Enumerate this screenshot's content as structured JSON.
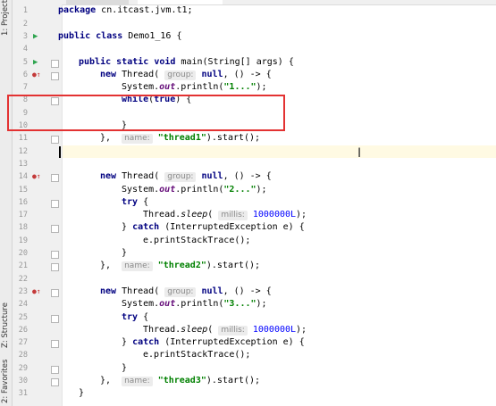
{
  "side_tabs": {
    "project": "1: Project",
    "structure": "Z: Structure",
    "favorites": "2: Favorites"
  },
  "gutter": {
    "run_icon": "run-arrow-icon",
    "override_icon": "override-icon"
  },
  "code": {
    "l1": "1",
    "l2": "2",
    "l3": "3",
    "l4": "4",
    "l5": "5",
    "l6": "6",
    "l7": "7",
    "l8": "8",
    "l9": "9",
    "l10": "10",
    "l11": "11",
    "l12": "12",
    "l13": "13",
    "l14": "14",
    "l15": "15",
    "l16": "16",
    "l17": "17",
    "l18": "18",
    "l19": "19",
    "l20": "20",
    "l21": "21",
    "l22": "22",
    "l23": "23",
    "l24": "24",
    "l25": "25",
    "l26": "26",
    "l27": "27",
    "l28": "28",
    "l29": "29",
    "l30": "30",
    "l31": "31",
    "kw_package": "package",
    "package_name": " cn.itcast.jvm.t1;",
    "kw_public": "public",
    "kw_class": "class",
    "class_name": " Demo1_16 {",
    "kw_static": "static",
    "kw_void": "void",
    "main_sig": " main(String[] args) {",
    "kw_new": "new",
    "thread_open": " Thread(",
    "hint_group": "group:",
    "kw_null": "null",
    "lambda_open": ", () -> {",
    "system_out_prefix": "System.",
    "system_out_field": "out",
    "println_open": ".println(",
    "str_1": "\"1...\"",
    "str_2": "\"2...\"",
    "str_3": "\"3...\"",
    "call_close": ");",
    "kw_while": "while",
    "while_open": "(",
    "kw_true": "true",
    "while_close": ") {",
    "brace_close": "}",
    "brace_comma": "},",
    "hint_name": "name:",
    "str_thread1": "\"thread1\"",
    "str_thread2": "\"thread2\"",
    "str_thread3": "\"thread3\"",
    "start_call": ").start();",
    "kw_try": "try",
    "brace_open": " {",
    "thread_prefix": "Thread.",
    "sleep_method": "sleep",
    "paren_open": "(",
    "hint_millis": "millis:",
    "num_sleep": "1000000L",
    "kw_catch": "catch",
    "catch_args": " (InterruptedException e) {",
    "print_stack": "e.printStackTrace();"
  }
}
